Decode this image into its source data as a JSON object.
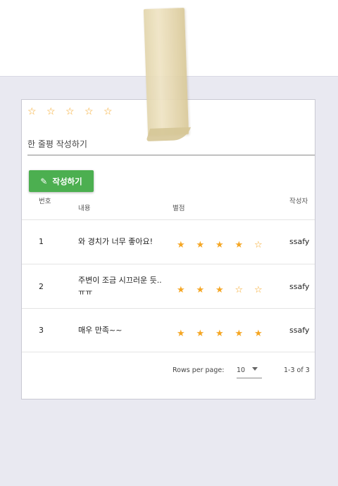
{
  "rating_input": {
    "stars": [
      "☆",
      "☆",
      "☆",
      "☆",
      "☆"
    ]
  },
  "review_field": {
    "placeholder": "한 줄평 작성하기"
  },
  "write_button": {
    "label": "작성하기",
    "icon": "pencil-icon"
  },
  "table": {
    "headers": {
      "number": "번호",
      "content": "내용",
      "rating": "별점",
      "author": "작성자"
    },
    "rows": [
      {
        "number": "1",
        "content": "와 경치가 너무 좋아요!",
        "rating": 4,
        "stars": [
          "★",
          "★",
          "★",
          "★",
          "☆"
        ],
        "author": "ssafy"
      },
      {
        "number": "2",
        "content": "주변이 조금 시끄러운 듯.. ㅠㅠ",
        "rating": 3,
        "stars": [
          "★",
          "★",
          "★",
          "☆",
          "☆"
        ],
        "author": "ssafy"
      },
      {
        "number": "3",
        "content": "매우 만족~~",
        "rating": 5,
        "stars": [
          "★",
          "★",
          "★",
          "★",
          "★"
        ],
        "author": "ssafy"
      }
    ]
  },
  "pagination": {
    "rows_per_page_label": "Rows per page:",
    "rows_per_page": "10",
    "range": "1-3 of 3"
  },
  "colors": {
    "accent_green": "#4caf50",
    "star": "#f5a623"
  }
}
